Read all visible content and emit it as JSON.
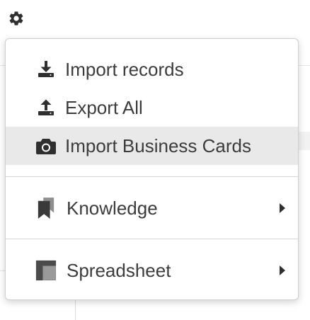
{
  "toolbar": {
    "settings_icon": "gear-icon"
  },
  "menu": {
    "items": [
      {
        "label": "Import records",
        "icon": "download-icon"
      },
      {
        "label": "Export All",
        "icon": "upload-icon"
      },
      {
        "label": "Import Business Cards",
        "icon": "camera-icon",
        "highlighted": true
      }
    ],
    "submenus": [
      {
        "label": "Knowledge",
        "icon": "knowledge-bookmarks-icon",
        "has_submenu": true
      },
      {
        "label": "Spreadsheet",
        "icon": "spreadsheet-icon",
        "has_submenu": true
      }
    ]
  },
  "colors": {
    "icon": "#2f2f2f",
    "text": "#3c3c3c",
    "highlight": "#e9e9e9",
    "spreadsheet_icon": "#8c8c8c"
  }
}
